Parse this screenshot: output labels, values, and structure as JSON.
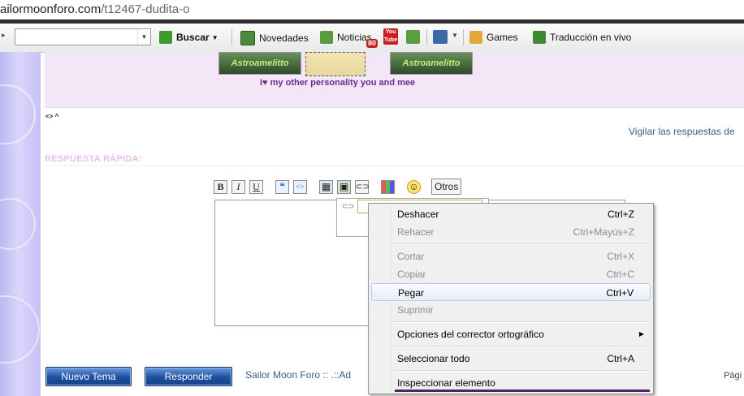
{
  "url": {
    "host_partial": "ailormoonforo.com",
    "path": "/t12467-dudita-o"
  },
  "toolbar": {
    "search_label": "Buscar",
    "items": [
      "Novedades",
      "Noticias",
      "Games",
      "Traducción en vivo"
    ],
    "noticias_badge": "80",
    "youtube_label": "You Tube"
  },
  "post": {
    "avatar_left_text": "Astroamelitto",
    "avatar_right_text": "Astroamelitto",
    "signature": "I♥ my other personality you and mee",
    "tiny_marks": "<> ^"
  },
  "vigilar_link": "Vigilar las respuestas de",
  "quick_reply": {
    "title": "RESPUESTA RÁPIDA:",
    "buttons": {
      "bold": "B",
      "italic": "I",
      "underline": "U",
      "otros": "Otros"
    }
  },
  "bottom": {
    "new_topic": "Nuevo Tema",
    "reply": "Responder",
    "breadcrumb": "Sailor Moon Foro :: .::Ad",
    "page": "Pági"
  },
  "context_menu": {
    "items": [
      {
        "label": "Deshacer",
        "shortcut": "Ctrl+Z",
        "disabled": false
      },
      {
        "label": "Rehacer",
        "shortcut": "Ctrl+Mayús+Z",
        "disabled": true
      },
      {
        "label": "Cortar",
        "shortcut": "Ctrl+X",
        "disabled": true
      },
      {
        "label": "Copiar",
        "shortcut": "Ctrl+C",
        "disabled": true
      },
      {
        "label": "Pegar",
        "shortcut": "Ctrl+V",
        "disabled": false,
        "highlighted": true
      },
      {
        "label": "Suprimir",
        "shortcut": "",
        "disabled": true
      },
      {
        "label": "Opciones del corrector ortográfico",
        "shortcut": "",
        "submenu": true
      },
      {
        "label": "Seleccionar todo",
        "shortcut": "Ctrl+A",
        "disabled": false
      },
      {
        "label": "Inspeccionar elemento",
        "shortcut": "",
        "disabled": false
      }
    ]
  },
  "colors": {
    "accent_link": "#3a5f82",
    "menu_highlight": "#aecdf0",
    "signature": "#6a2d8a"
  }
}
